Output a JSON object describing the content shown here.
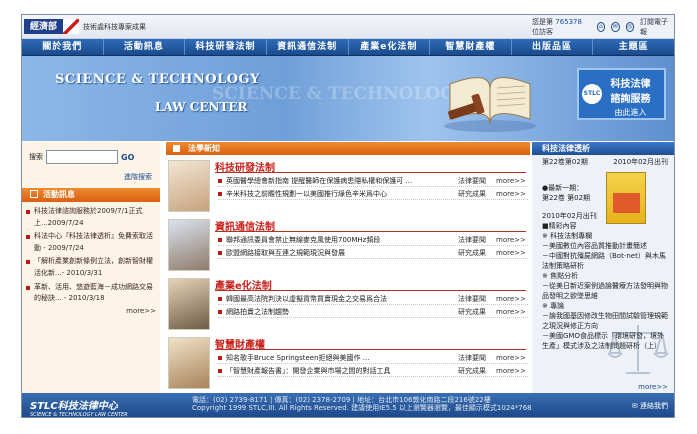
{
  "header": {
    "org": "經濟部",
    "dept": "技術處科技專案成果",
    "visitor_prefix": "您是第",
    "visitor_count": "765378",
    "visitor_suffix": "位訪客",
    "subscribe": "訂閱電子報"
  },
  "nav": [
    "關於我們",
    "活動訊息",
    "科技研發法制",
    "資訊通信法制",
    "產業e化法制",
    "智慧財產權",
    "出版品區",
    "主題區"
  ],
  "banner": {
    "title1": "SCIENCE & TECHNOLOGY",
    "title2": "LAW CENTER",
    "promo_l1": "科技法律",
    "promo_l2": "諮詢服務",
    "promo_l3": "由此進入",
    "promo_logo": "STLC"
  },
  "search": {
    "label": "搜索",
    "button": "GO",
    "advanced": "進階搜索"
  },
  "events": {
    "title": "活動訊息",
    "items": [
      "科技法律諮詢服務於2009/7/1正式上...2009/7/24",
      "科法中心『科技法律透析』免費索取活動 - 2009/7/24",
      "「解析產業創新條例立法，創新智財權活化新...- 2010/3/31",
      "革新、活用、悠遊藍海－成功網路交易的秘訣... - 2010/3/18"
    ],
    "more": "more>>"
  },
  "main": {
    "title": "法學新知",
    "sections": [
      {
        "title": "科技研發法制",
        "rows": [
          {
            "text": "英國醫學總會新指南 提醒醫師在保護病患隱私權和保護可 ...",
            "cat": "法律要聞",
            "more": "more>>"
          },
          {
            "text": "辛米科技之前瞻性規劃一以美國推行綠色辛米爲中心",
            "cat": "研究成果",
            "more": "more>>"
          }
        ]
      },
      {
        "title": "資訊通信法制",
        "rows": [
          {
            "text": "聯邦通訊委員會禁止無線麥克風使用700MHz頻段",
            "cat": "法律要聞",
            "more": "more>>"
          },
          {
            "text": "歐盟網路接取與互連之規範現況與發展",
            "cat": "研究成果",
            "more": "more>>"
          }
        ]
      },
      {
        "title": "產業e化法制",
        "rows": [
          {
            "text": "韓國最高法院判決以虛擬貨幣買賣現金之交易爲合法",
            "cat": "法律要聞",
            "more": "more>>"
          },
          {
            "text": "網路拍賣之法制趨勢",
            "cat": "研究成果",
            "more": "more>>"
          }
        ]
      },
      {
        "title": "智慧財產權",
        "rows": [
          {
            "text": "知名歌手Bruce Springsteen拒絕與美國作 ...",
            "cat": "法律要聞",
            "more": "more>>"
          },
          {
            "text": "「智慧財產報告書」：開發企業與市場之間的對話工具",
            "cat": "研究成果",
            "more": "more>>"
          }
        ]
      }
    ]
  },
  "journal": {
    "title": "科技法律透析",
    "issue": "第22卷第02期",
    "date": "2010年02月出刊",
    "latest_label": "●最新一期：",
    "latest_issue": "第22卷 第02期",
    "latest_date": "2010年02月出刊",
    "lines": [
      "■精彩內容",
      "※ 科技法制專欄",
      "－美國數位內容品質推動計畫簡述",
      "－中國對抗殭屍網路（Bot-net）與木馬法制策略研析",
      "※ 焦點分析",
      "－從美日新近案例過論醫療方法發明與物品發明之欲墜思維",
      "※ 專論",
      "－論我國基因修改生物田間試驗管理規範之現況與修正方向",
      "－美國GMO食品標示「環境研發，境外生產」模式涉及之法制問題研析（上）"
    ],
    "more": "more>>"
  },
  "footer": {
    "logo": "STLC科技法律中心",
    "logo_sub": "SCIENCE & TECHNOLOGY LAW CENTER",
    "line1": "電話：(02) 2739-8171 | 傳真：(02) 2378-2709 | 地址：台北市106敦化南路二段216號22樓",
    "line2": "Copyright 1999 STLC,III. All Rights Reserved. 建議使用IE5.5 以上瀏覽器瀏覽，最佳顯示模式1024*768",
    "contact": "連絡我們"
  }
}
